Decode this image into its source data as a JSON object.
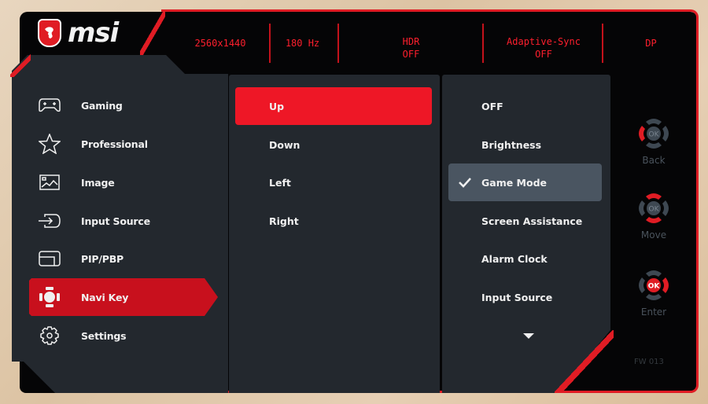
{
  "brand": {
    "logo_text": "msi",
    "logo_icon": "dragon-shield-icon"
  },
  "header": {
    "status_items": [
      {
        "lines": [
          "2560x1440"
        ]
      },
      {
        "lines": [
          "180 Hz"
        ]
      },
      {
        "lines": [
          "HDR",
          "OFF"
        ]
      },
      {
        "lines": [
          "Adaptive-Sync",
          "OFF"
        ]
      },
      {
        "lines": [
          "DP"
        ]
      }
    ]
  },
  "sidebar": {
    "items": [
      {
        "label": "Gaming",
        "icon": "gamepad-icon",
        "active": false
      },
      {
        "label": "Professional",
        "icon": "star-icon",
        "active": false
      },
      {
        "label": "Image",
        "icon": "image-icon",
        "active": false
      },
      {
        "label": "Input Source",
        "icon": "input-source-icon",
        "active": false
      },
      {
        "label": "PIP/PBP",
        "icon": "pip-icon",
        "active": false
      },
      {
        "label": "Navi Key",
        "icon": "navi-key-icon",
        "active": true
      },
      {
        "label": "Settings",
        "icon": "gear-icon",
        "active": false
      }
    ]
  },
  "submenu": {
    "items": [
      {
        "label": "Up",
        "active": true
      },
      {
        "label": "Down",
        "active": false
      },
      {
        "label": "Left",
        "active": false
      },
      {
        "label": "Right",
        "active": false
      }
    ]
  },
  "options": {
    "items": [
      {
        "label": "OFF",
        "selected": false
      },
      {
        "label": "Brightness",
        "selected": false
      },
      {
        "label": "Game Mode",
        "selected": true
      },
      {
        "label": "Screen Assistance",
        "selected": false
      },
      {
        "label": "Alarm Clock",
        "selected": false
      },
      {
        "label": "Input Source",
        "selected": false
      }
    ],
    "more_indicator": "chevron-down-icon"
  },
  "nav_hints": [
    {
      "label": "Back",
      "highlight": "left"
    },
    {
      "label": "Move",
      "highlight": "updown"
    },
    {
      "label": "Enter",
      "highlight": "ok-right"
    }
  ],
  "dpad_center_label": "OK",
  "firmware": "FW 013",
  "colors": {
    "accent_red": "#e01c24",
    "active_red": "#c8101d",
    "bright_red": "#ee1726",
    "panel_bg": "#23282e",
    "selected_bg": "#4a5561",
    "status_text": "#ff1f2d",
    "hint_gray": "#4a535c"
  }
}
